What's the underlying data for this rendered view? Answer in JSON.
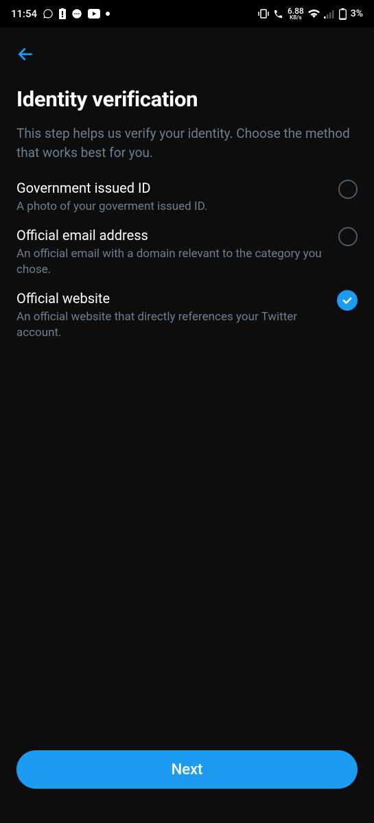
{
  "status": {
    "time": "11:54",
    "kbs_value": "6.88",
    "kbs_label": "KB/s",
    "battery": "3%"
  },
  "header": {
    "title": "Identity verification",
    "subtitle": "This step helps us verify your identity. Choose the method that works best for you."
  },
  "options": [
    {
      "title": "Government issued ID",
      "desc": "A photo of your goverment issued ID.",
      "selected": false
    },
    {
      "title": "Official email address",
      "desc": "An official email with a domain relevant to the category you chose.",
      "selected": false
    },
    {
      "title": "Official website",
      "desc": "An official website that directly references your Twitter account.",
      "selected": true
    }
  ],
  "actions": {
    "next_label": "Next"
  },
  "colors": {
    "accent": "#1d9bf0",
    "muted": "#6a7f8f"
  }
}
